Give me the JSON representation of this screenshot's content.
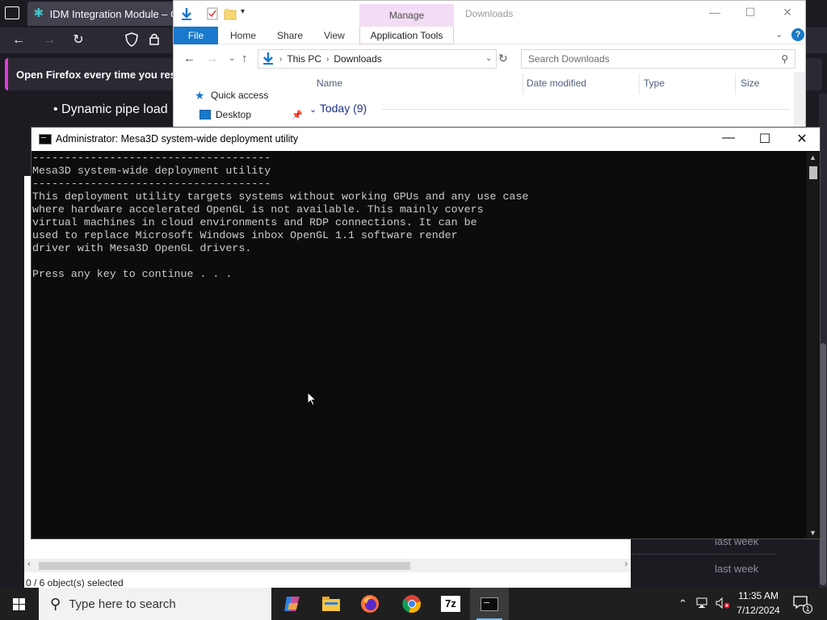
{
  "firefox": {
    "tab_title": "IDM Integration Module – Ge",
    "notification": "Open Firefox every time you restar",
    "bullet_text": "Dynamic pipe load",
    "list_rows": [
      "last week",
      "last week"
    ]
  },
  "explorer": {
    "title": "Downloads",
    "contextual_tab": "Manage",
    "ribbon": {
      "file": "File",
      "tabs": [
        "Home",
        "Share",
        "View"
      ],
      "app_tools": "Application Tools",
      "help": "?"
    },
    "address": {
      "segments": [
        "This PC",
        "Downloads"
      ]
    },
    "search": {
      "placeholder": "Search Downloads"
    },
    "nav_pane": {
      "items": [
        "Quick access",
        "Desktop"
      ]
    },
    "columns": [
      "Name",
      "Date modified",
      "Type",
      "Size"
    ],
    "group_header": "Today (9)",
    "status_text": "0 / 6 object(s) selected"
  },
  "console": {
    "title": "Administrator:  Mesa3D system-wide deployment utility",
    "lines": [
      "-------------------------------------",
      "Mesa3D system-wide deployment utility",
      "-------------------------------------",
      "This deployment utility targets systems without working GPUs and any use case",
      "where hardware accelerated OpenGL is not available. This mainly covers",
      "virtual machines in cloud environments and RDP connections. It can be",
      "used to replace Microsoft Windows inbox OpenGL 1.1 software render",
      "driver with Mesa3D OpenGL drivers.",
      "",
      "Press any key to continue . . ."
    ]
  },
  "taskbar": {
    "search_placeholder": "Type here to search",
    "apps": [
      "copilot-icon",
      "file-explorer-icon",
      "firefox-icon",
      "chrome-icon",
      "7zip-icon",
      "terminal-icon"
    ],
    "zip_label": "7z",
    "time": "11:35 AM",
    "date": "7/12/2024",
    "notification_count": "1"
  },
  "colors": {
    "accent": "#1979ca",
    "console_bg": "#0c0c0c",
    "console_text": "#cccccc",
    "firefox_bg": "#1c1b22",
    "taskbar_bg": "#1f1f1f"
  }
}
